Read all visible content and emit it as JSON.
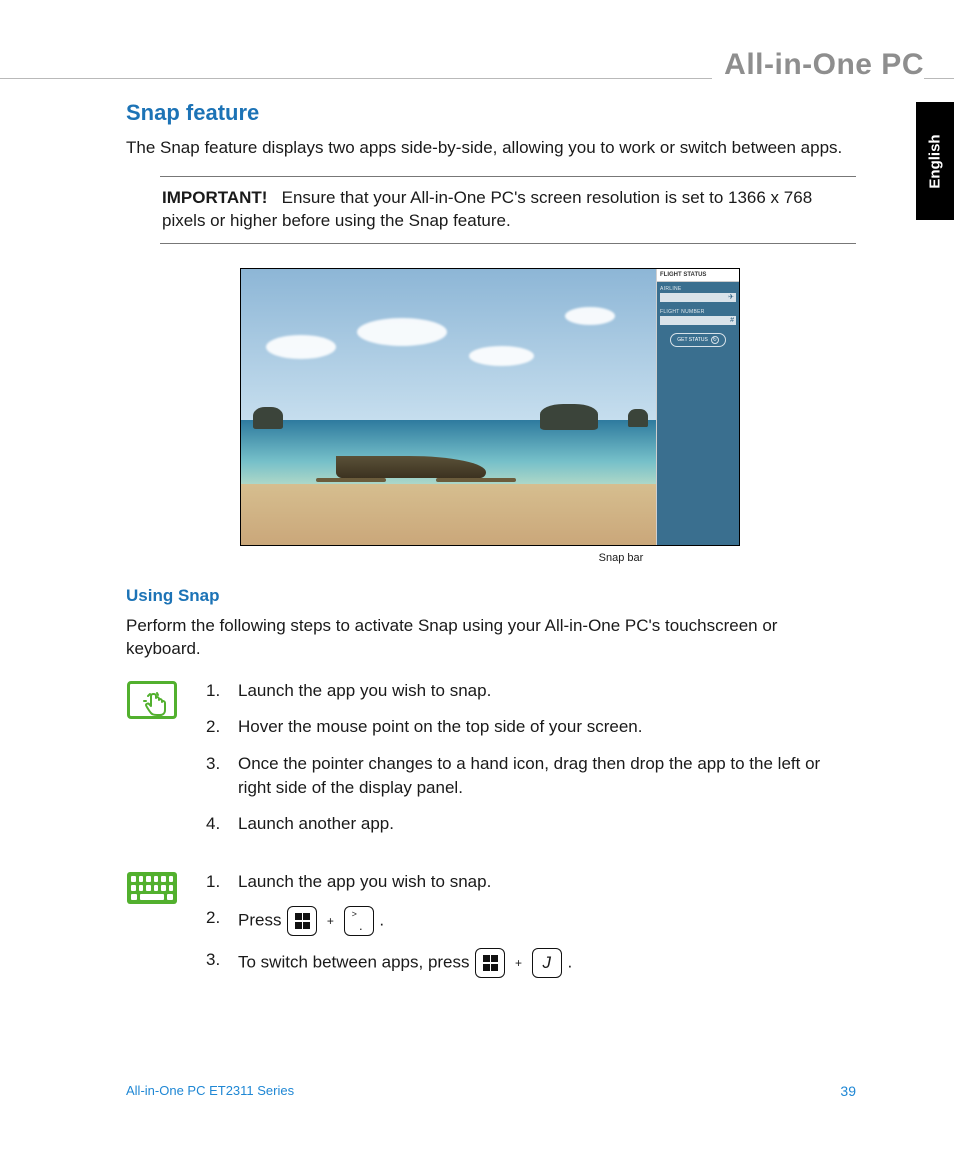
{
  "header": {
    "product_line": "All-in-One PC"
  },
  "lang_tab": "English",
  "section": {
    "title": "Snap feature",
    "intro": "The Snap feature displays two apps side-by-side, allowing you to work or switch between apps.",
    "note_label": "IMPORTANT!",
    "note_text": "Ensure that your All-in-One PC's screen resolution is set to 1366 x 768 pixels or higher before using the Snap feature."
  },
  "screenshot": {
    "right_pane": {
      "title": "FLIGHT STATUS",
      "field1_label": "AIRLINE",
      "field2_label": "FLIGHT NUMBER",
      "button": "GET STATUS"
    },
    "caption": "Snap bar"
  },
  "using": {
    "heading": "Using Snap",
    "intro": "Perform the following steps to activate Snap using your All-in-One PC's touchscreen or keyboard.",
    "touch_steps": [
      "Launch the app you wish to snap.",
      "Hover the mouse point on the top side of your screen.",
      "Once the pointer changes to a hand icon, drag then drop the app to the left or right side of the display panel.",
      "Launch another app."
    ],
    "kbd_steps": {
      "s1": "Launch the app you wish to snap.",
      "s2_pre": "Press ",
      "s2_post": " .",
      "s3_pre": "To switch between apps, press ",
      "s3_key2": "J",
      "s3_post": " ."
    }
  },
  "footer": {
    "series": "All-in-One PC ET2311 Series",
    "page": "39"
  }
}
